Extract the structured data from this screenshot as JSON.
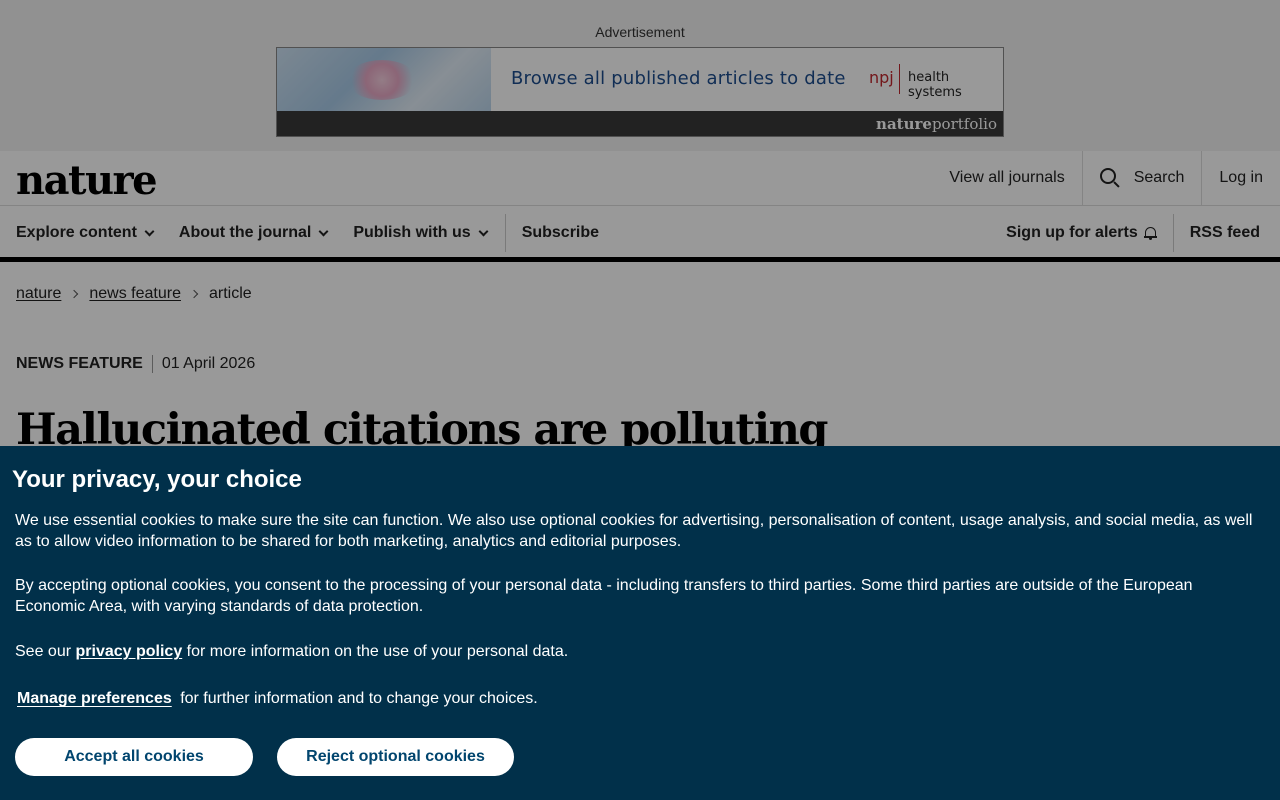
{
  "ad": {
    "label": "Advertisement",
    "headline": "Browse all published articles to date",
    "brand_npj": "npj",
    "brand_journal": "health systems",
    "portfolio_bold": "nature",
    "portfolio_light": "portfolio"
  },
  "header": {
    "logo": "nature",
    "top_links": [
      "View all journals",
      "Search",
      "Log in"
    ],
    "nav": [
      "Explore content",
      "About the journal",
      "Publish with us",
      "Subscribe"
    ],
    "nav_right": [
      "Sign up for alerts",
      "RSS feed"
    ]
  },
  "breadcrumb": [
    "nature",
    "news feature",
    "article"
  ],
  "article": {
    "type": "NEWS FEATURE",
    "date": "01 April 2026",
    "headline": "Hallucinated citations are polluting"
  },
  "cookie": {
    "title": "Your privacy, your choice",
    "p1": "We use essential cookies to make sure the site can function. We also use optional cookies for advertising, personalisation of content, usage analysis, and social media, as well as to allow video information to be shared for both marketing, analytics and editorial purposes.",
    "p2": "By accepting optional cookies, you consent to the processing of your personal data - including transfers to third parties. Some third parties are outside of the European Economic Area, with varying standards of data protection.",
    "p3_pre": "See our",
    "p3_link": "privacy policy",
    "p3_post": "for more information on the use of your personal data.",
    "p4_link": "Manage preferences",
    "p4_post": "for further information and to change your choices.",
    "accept": "Accept all cookies",
    "reject": "Reject optional cookies"
  },
  "colors": {
    "cookie_bg": "#01304a",
    "button_text": "#01456e",
    "npj_red": "#c0272d"
  }
}
